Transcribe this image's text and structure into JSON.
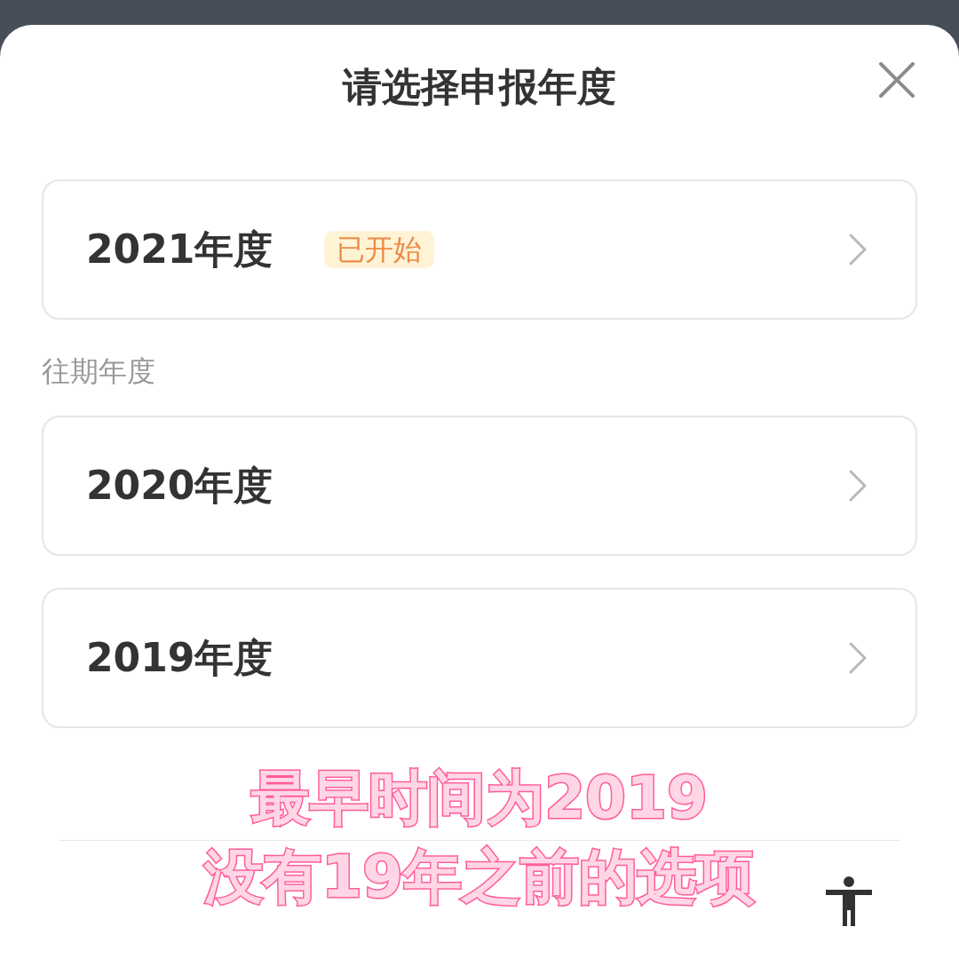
{
  "sheet": {
    "title": "请选择申报年度"
  },
  "current_year": {
    "label": "2021年度",
    "badge": "已开始"
  },
  "section_label": "往期年度",
  "past_years": [
    {
      "label": "2020年度"
    },
    {
      "label": "2019年度"
    }
  ],
  "caption": [
    "最早时间为2019",
    "没有19年之前的选项"
  ]
}
